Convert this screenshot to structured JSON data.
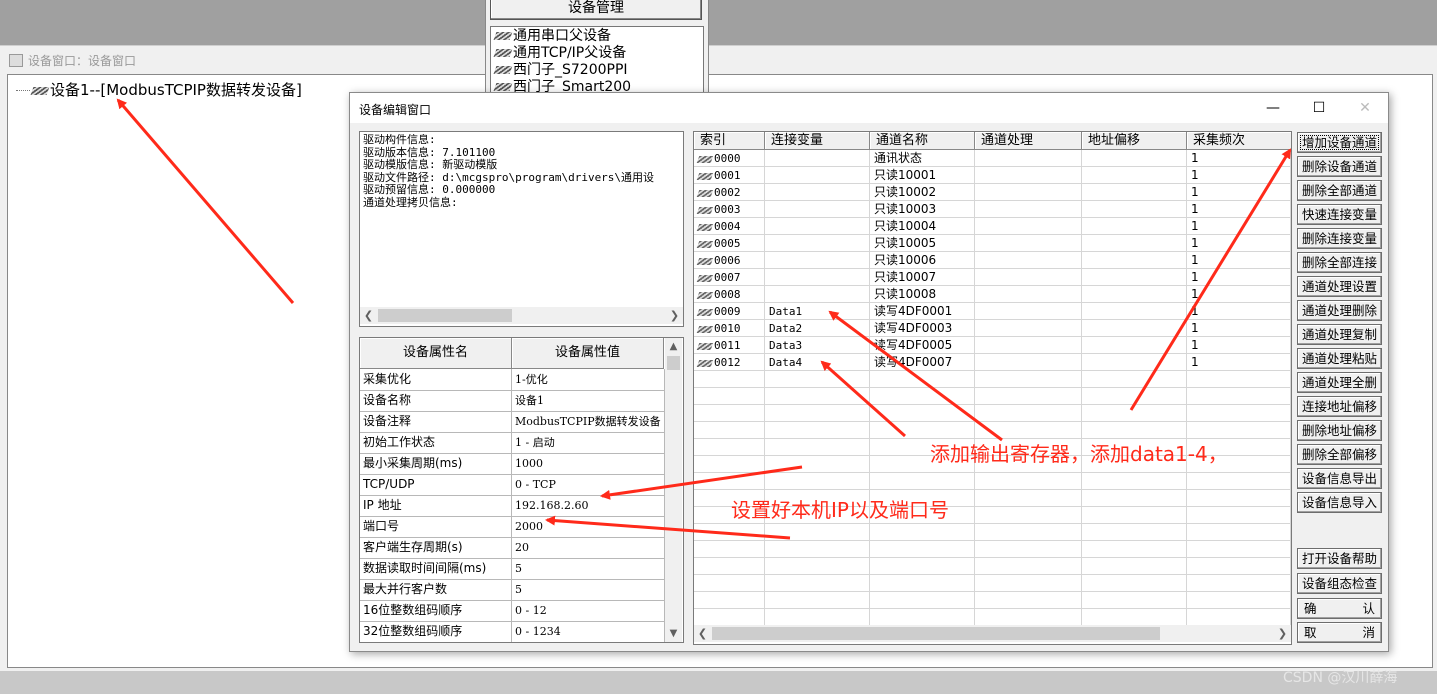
{
  "device_manager": {
    "button_label": "设备管理",
    "items": [
      "通用串口父设备",
      "通用TCP/IP父设备",
      "西门子_S7200PPI",
      "西门子_Smart200"
    ]
  },
  "device_window": {
    "title": "设备窗口：设备窗口",
    "tree_node": "设备1--[ModbusTCPIP数据转发设备]"
  },
  "dialog": {
    "title": "设备编辑窗口",
    "window_buttons": {
      "minimize": "—",
      "maximize": "☐",
      "close": "✕"
    },
    "info_lines": [
      "驱动构件信息:",
      "驱动版本信息: 7.101100",
      "驱动模版信息: 新驱动模版",
      "驱动文件路径: d:\\mcgspro\\program\\drivers\\通用设",
      "驱动预留信息: 0.000000",
      "通道处理拷贝信息:"
    ],
    "props": {
      "headers": [
        "设备属性名",
        "设备属性值"
      ],
      "rows": [
        [
          "采集优化",
          "1-优化"
        ],
        [
          "设备名称",
          "设备1"
        ],
        [
          "设备注释",
          "ModbusTCPIP数据转发设备"
        ],
        [
          "初始工作状态",
          "1 - 启动"
        ],
        [
          "最小采集周期(ms)",
          "1000"
        ],
        [
          "TCP/UDP",
          "0 - TCP"
        ],
        [
          "IP 地址",
          "192.168.2.60"
        ],
        [
          "端口号",
          "2000"
        ],
        [
          "客户端生存周期(s)",
          "20"
        ],
        [
          "数据读取时间间隔(ms)",
          "5"
        ],
        [
          "最大并行客户数",
          "5"
        ],
        [
          "16位整数组码顺序",
          "0 - 12"
        ],
        [
          "32位整数组码顺序",
          "0 - 1234"
        ]
      ]
    },
    "channels": {
      "headers": [
        "索引",
        "连接变量",
        "通道名称",
        "通道处理",
        "地址偏移",
        "采集频次"
      ],
      "rows": [
        [
          "0000",
          "",
          "通讯状态",
          "",
          "",
          "1"
        ],
        [
          "0001",
          "",
          "只读10001",
          "",
          "",
          "1"
        ],
        [
          "0002",
          "",
          "只读10002",
          "",
          "",
          "1"
        ],
        [
          "0003",
          "",
          "只读10003",
          "",
          "",
          "1"
        ],
        [
          "0004",
          "",
          "只读10004",
          "",
          "",
          "1"
        ],
        [
          "0005",
          "",
          "只读10005",
          "",
          "",
          "1"
        ],
        [
          "0006",
          "",
          "只读10006",
          "",
          "",
          "1"
        ],
        [
          "0007",
          "",
          "只读10007",
          "",
          "",
          "1"
        ],
        [
          "0008",
          "",
          "只读10008",
          "",
          "",
          "1"
        ],
        [
          "0009",
          "Data1",
          "读写4DF0001",
          "",
          "",
          "1"
        ],
        [
          "0010",
          "Data2",
          "读写4DF0003",
          "",
          "",
          "1"
        ],
        [
          "0011",
          "Data3",
          "读写4DF0005",
          "",
          "",
          "1"
        ],
        [
          "0012",
          "Data4",
          "读写4DF0007",
          "",
          "",
          "1"
        ]
      ]
    },
    "buttons": [
      "增加设备通道",
      "删除设备通道",
      "删除全部通道",
      "快速连接变量",
      "删除连接变量",
      "删除全部连接",
      "通道处理设置",
      "通道处理删除",
      "通道处理复制",
      "通道处理粘贴",
      "通道处理全删",
      "连接地址偏移",
      "删除地址偏移",
      "删除全部偏移",
      "设备信息导出",
      "设备信息导入"
    ],
    "bottom_buttons": [
      "打开设备帮助",
      "设备组态检查"
    ],
    "confirm": [
      "确",
      "认"
    ],
    "cancel": [
      "取",
      "消"
    ]
  },
  "annotations": {
    "channels_note": "添加输出寄存器，添加data1-4，",
    "ip_note": "设置好本机IP以及端口号",
    "color": "#ff2a1a"
  },
  "watermark": "CSDN @汉川薛海"
}
